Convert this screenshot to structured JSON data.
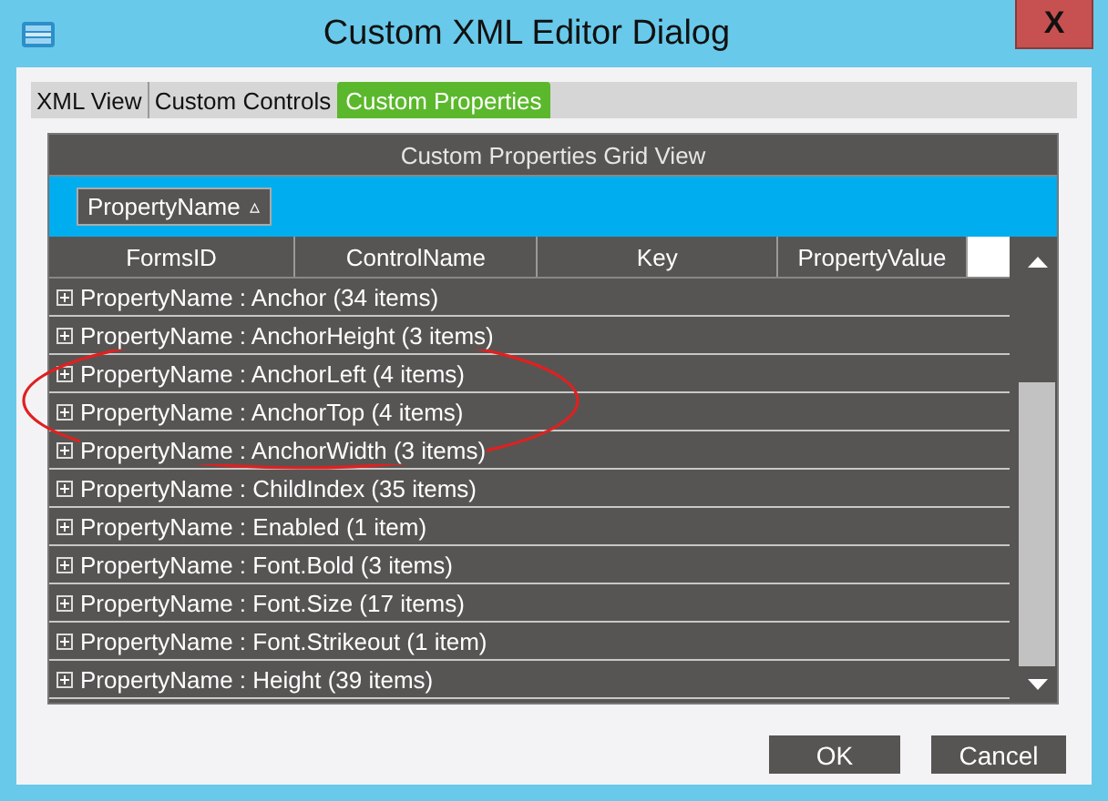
{
  "window": {
    "title": "Custom XML Editor Dialog",
    "close_label": "X"
  },
  "tabs": [
    {
      "label": "XML View",
      "selected": false
    },
    {
      "label": "Custom Controls",
      "selected": false
    },
    {
      "label": "Custom Properties",
      "selected": true
    }
  ],
  "grid": {
    "title": "Custom Properties Grid View",
    "group_by": {
      "label": "PropertyName",
      "sort_glyph": "▵"
    },
    "columns": [
      "FormsID",
      "ControlName",
      "Key",
      "PropertyValue"
    ],
    "rows": [
      {
        "label": "PropertyName : Anchor (34 items)",
        "expanded": false
      },
      {
        "label": "PropertyName : AnchorHeight (3 items)",
        "expanded": false
      },
      {
        "label": "PropertyName : AnchorLeft (4 items)",
        "expanded": false
      },
      {
        "label": "PropertyName : AnchorTop (4 items)",
        "expanded": false
      },
      {
        "label": "PropertyName : AnchorWidth (3 items)",
        "expanded": false
      },
      {
        "label": "PropertyName : ChildIndex (35 items)",
        "expanded": false
      },
      {
        "label": "PropertyName : Enabled (1 item)",
        "expanded": false
      },
      {
        "label": "PropertyName : Font.Bold (3 items)",
        "expanded": false
      },
      {
        "label": "PropertyName : Font.Size (17 items)",
        "expanded": false
      },
      {
        "label": "PropertyName : Font.Strikeout (1 item)",
        "expanded": false
      },
      {
        "label": "PropertyName : Height (39 items)",
        "expanded": false
      }
    ]
  },
  "buttons": [
    "OK",
    "Cancel"
  ]
}
